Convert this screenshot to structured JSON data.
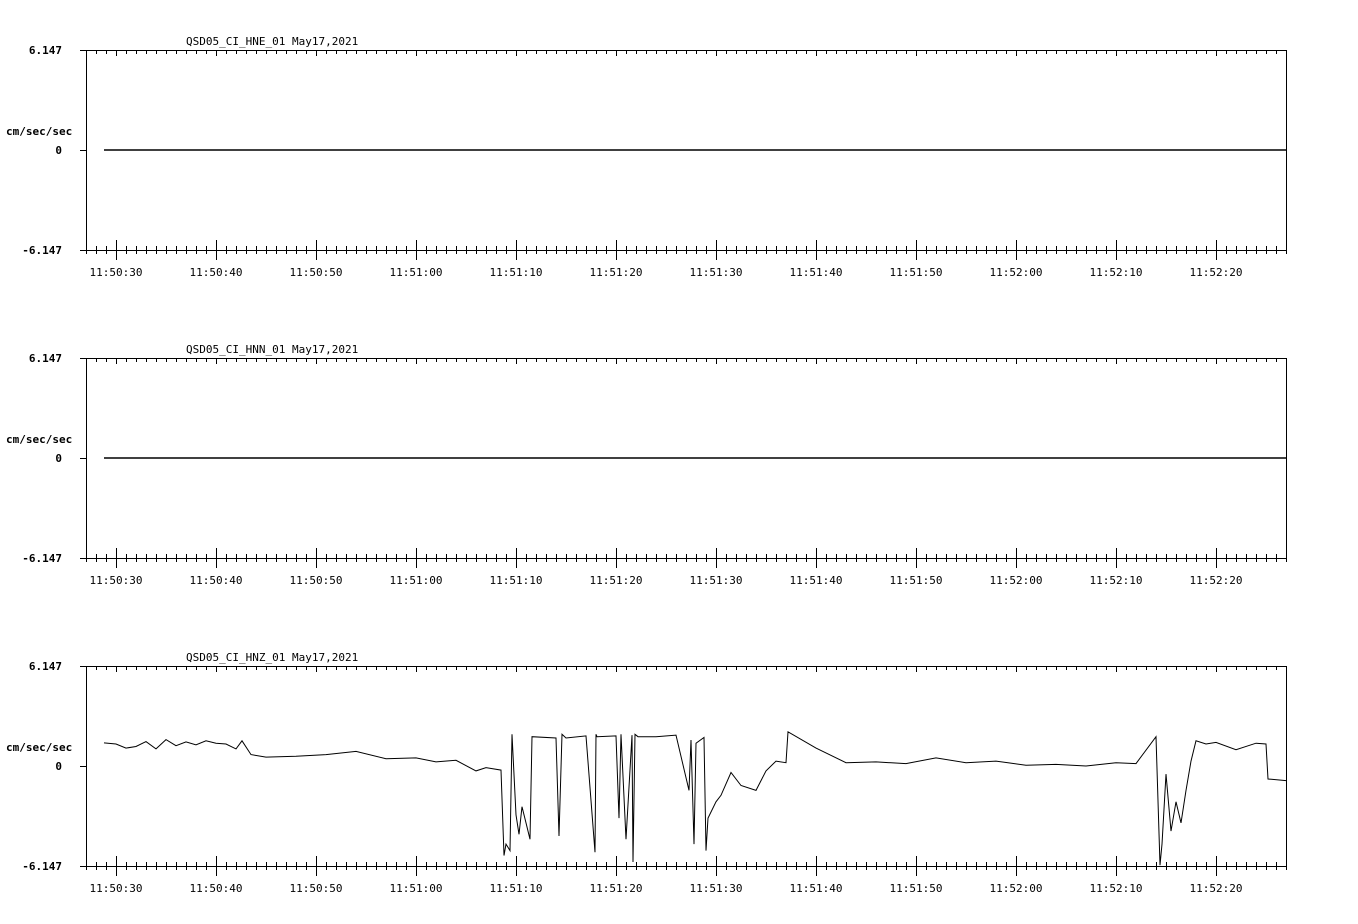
{
  "chart_data": [
    {
      "type": "line",
      "title": "QSD05_CI_HNE_01  May17,2021",
      "ylabel": "cm/sec/sec",
      "ylim": [
        -6.147,
        6.147
      ],
      "y_tick_labels": [
        "6.147",
        "0",
        "-6.147"
      ],
      "xlim": [
        "11:50:27.0",
        "11:52:27.0"
      ],
      "x_tick_labels": [
        "11:50:30",
        "11:50:40",
        "11:50:50",
        "11:51:00",
        "11:51:10",
        "11:51:20",
        "11:51:30",
        "11:51:40",
        "11:51:50",
        "11:52:00",
        "11:52:10",
        "11:52:20"
      ],
      "series": [
        {
          "color": "#000000",
          "x": [
            "11:50:28.8",
            "11:52:27.0"
          ],
          "y": [
            0.0,
            0.0
          ]
        }
      ]
    },
    {
      "type": "line",
      "title": "QSD05_CI_HNN_01  May17,2021",
      "ylabel": "cm/sec/sec",
      "ylim": [
        -6.147,
        6.147
      ],
      "y_tick_labels": [
        "6.147",
        "0",
        "-6.147"
      ],
      "xlim": [
        "11:50:27.0",
        "11:52:27.0"
      ],
      "x_tick_labels": [
        "11:50:30",
        "11:50:40",
        "11:50:50",
        "11:51:00",
        "11:51:10",
        "11:51:20",
        "11:51:30",
        "11:51:40",
        "11:51:50",
        "11:52:00",
        "11:52:10",
        "11:52:20"
      ],
      "series": [
        {
          "color": "#000000",
          "x": [
            "11:50:28.8",
            "11:52:27.0"
          ],
          "y": [
            0.0,
            0.0
          ]
        }
      ]
    },
    {
      "type": "line",
      "title": "QSD05_CI_HNZ_01  May17,2021",
      "ylabel": "cm/sec/sec",
      "ylim": [
        -6.147,
        6.147
      ],
      "y_tick_labels": [
        "6.147",
        "0",
        "-6.147"
      ],
      "xlim": [
        "11:50:27.0",
        "11:52:27.0"
      ],
      "x_tick_labels": [
        "11:50:30",
        "11:50:40",
        "11:50:50",
        "11:51:00",
        "11:51:10",
        "11:51:20",
        "11:51:30",
        "11:51:40",
        "11:51:50",
        "11:52:00",
        "11:52:10",
        "11:52:20"
      ],
      "series": [
        {
          "color": "#000000",
          "x": [
            "11:50:28.8",
            "11:50:30.0",
            "11:50:31.0",
            "11:50:32.0",
            "11:50:33.0",
            "11:50:34.0",
            "11:50:35.0",
            "11:50:36.0",
            "11:50:37.0",
            "11:50:38.0",
            "11:50:39.0",
            "11:50:40.0",
            "11:50:41.0",
            "11:50:42.0",
            "11:50:42.6",
            "11:50:43.5",
            "11:50:45.0",
            "11:50:48.0",
            "11:50:51.0",
            "11:50:54.0",
            "11:50:57.0",
            "11:51:00.0",
            "11:51:02.0",
            "11:51:04.0",
            "11:51:06.0",
            "11:51:07.0",
            "11:51:08.5",
            "11:51:08.8",
            "11:51:09.0",
            "11:51:09.4",
            "11:51:09.6",
            "11:51:10.0",
            "11:51:10.3",
            "11:51:10.6",
            "11:51:11.0",
            "11:51:11.4",
            "11:51:11.6",
            "11:51:14.0",
            "11:51:14.3",
            "11:51:14.6",
            "11:51:15.0",
            "11:51:17.0",
            "11:51:17.9",
            "11:51:18.0",
            "11:51:18.1",
            "11:51:20.0",
            "11:51:20.3",
            "11:51:20.5",
            "11:51:21.0",
            "11:51:21.6",
            "11:51:21.7",
            "11:51:21.9",
            "11:51:22.2",
            "11:51:24.0",
            "11:51:26.0",
            "11:51:27.3",
            "11:51:27.5",
            "11:51:27.8",
            "11:51:28.0",
            "11:51:28.8",
            "11:51:29.0",
            "11:51:29.2",
            "11:51:30.0",
            "11:51:30.5",
            "11:51:31.5",
            "11:51:32.5",
            "11:51:34.0",
            "11:51:35.0",
            "11:51:36.0",
            "11:51:37.0",
            "11:51:37.2",
            "11:51:40.0",
            "11:51:43.0",
            "11:51:46.0",
            "11:51:49.0",
            "11:51:52.0",
            "11:51:55.0",
            "11:51:58.0",
            "11:52:01.0",
            "11:52:04.0",
            "11:52:07.0",
            "11:52:10.0",
            "11:52:12.0",
            "11:52:14.0",
            "11:52:14.4",
            "11:52:14.6",
            "11:52:15.0",
            "11:52:15.5",
            "11:52:16.0",
            "11:52:16.5",
            "11:52:17.0",
            "11:52:17.5",
            "11:52:18.0",
            "11:52:19.0",
            "11:52:20.0",
            "11:52:22.0",
            "11:52:24.0",
            "11:52:25.0",
            "11:52:25.2",
            "11:52:27.0"
          ],
          "y": [
            1.42,
            1.35,
            1.1,
            1.2,
            1.5,
            1.05,
            1.62,
            1.25,
            1.48,
            1.3,
            1.55,
            1.4,
            1.35,
            1.05,
            1.55,
            0.7,
            0.55,
            0.6,
            0.7,
            0.9,
            0.45,
            0.5,
            0.25,
            0.35,
            -0.3,
            -0.1,
            -0.25,
            -5.5,
            -4.8,
            -5.2,
            1.95,
            -3.0,
            -4.2,
            -2.5,
            -3.5,
            -4.5,
            1.8,
            1.72,
            -4.3,
            1.95,
            1.72,
            1.85,
            -5.3,
            1.95,
            1.8,
            1.85,
            -3.2,
            1.95,
            -4.5,
            1.9,
            -5.9,
            1.95,
            1.8,
            1.8,
            1.9,
            -1.5,
            1.6,
            -4.8,
            1.4,
            1.75,
            -5.2,
            -3.2,
            -2.2,
            -1.8,
            -0.4,
            -1.2,
            -1.5,
            -0.3,
            0.3,
            0.2,
            2.1,
            1.1,
            0.2,
            0.25,
            0.15,
            0.5,
            0.2,
            0.3,
            0.05,
            0.1,
            0.0,
            0.2,
            0.15,
            1.8,
            -6.1,
            -4.8,
            -0.5,
            -4.0,
            -2.2,
            -3.5,
            -1.5,
            0.3,
            1.55,
            1.35,
            1.45,
            1.0,
            1.4,
            1.35,
            -0.8,
            -0.9
          ]
        }
      ]
    }
  ]
}
